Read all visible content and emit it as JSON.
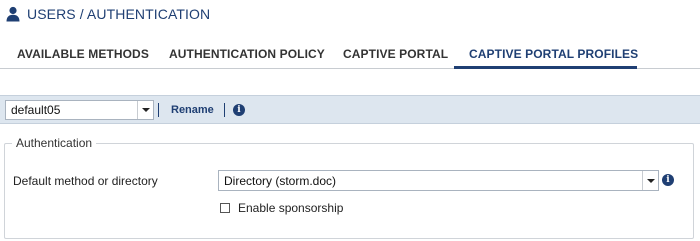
{
  "header": {
    "title": "USERS / AUTHENTICATION",
    "icon": "user-icon"
  },
  "tabs": [
    {
      "label": "AVAILABLE METHODS",
      "active": false
    },
    {
      "label": "AUTHENTICATION POLICY",
      "active": false
    },
    {
      "label": "CAPTIVE PORTAL",
      "active": false
    },
    {
      "label": "CAPTIVE PORTAL PROFILES",
      "active": true
    }
  ],
  "toolbar": {
    "profile_value": "default05",
    "rename_label": "Rename",
    "info_icon": "info-icon"
  },
  "authentication": {
    "legend": "Authentication",
    "method_label": "Default method or directory",
    "method_value": "Directory (storm.doc)",
    "sponsorship_label": "Enable sponsorship",
    "sponsorship_checked": false
  },
  "colors": {
    "accent": "#1f3f73",
    "toolbar_bg": "#dde6ef",
    "border": "#c8ccd1"
  }
}
